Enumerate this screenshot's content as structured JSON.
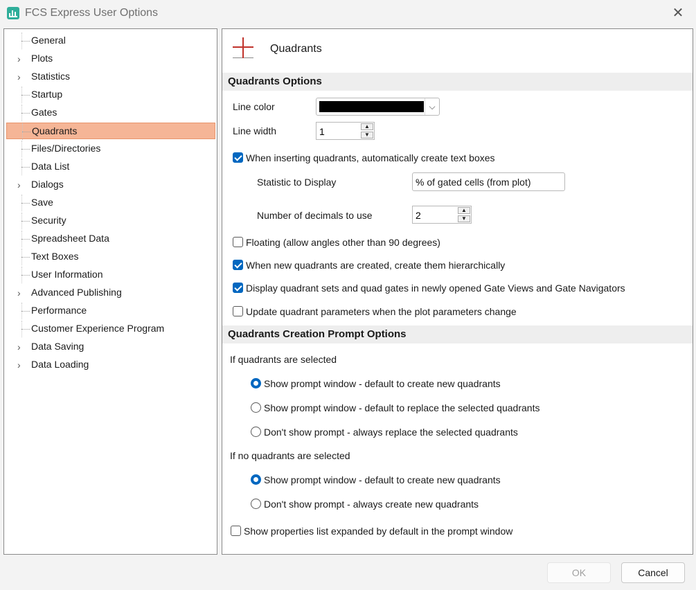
{
  "window": {
    "title": "FCS Express User Options"
  },
  "tree": {
    "items": [
      {
        "label": "General",
        "expandable": false
      },
      {
        "label": "Plots",
        "expandable": true
      },
      {
        "label": "Statistics",
        "expandable": true
      },
      {
        "label": "Startup",
        "expandable": false
      },
      {
        "label": "Gates",
        "expandable": false
      },
      {
        "label": "Quadrants",
        "expandable": false,
        "selected": true
      },
      {
        "label": "Files/Directories",
        "expandable": false
      },
      {
        "label": "Data List",
        "expandable": false
      },
      {
        "label": "Dialogs",
        "expandable": true
      },
      {
        "label": "Save",
        "expandable": false
      },
      {
        "label": "Security",
        "expandable": false
      },
      {
        "label": "Spreadsheet Data",
        "expandable": false
      },
      {
        "label": "Text Boxes",
        "expandable": false
      },
      {
        "label": "User Information",
        "expandable": false
      },
      {
        "label": "Advanced Publishing",
        "expandable": true
      },
      {
        "label": "Performance",
        "expandable": false
      },
      {
        "label": "Customer Experience Program",
        "expandable": false
      },
      {
        "label": "Data Saving",
        "expandable": true
      },
      {
        "label": "Data Loading",
        "expandable": true
      }
    ]
  },
  "panel": {
    "header_title": "Quadrants",
    "section1": "Quadrants Options",
    "line_color_label": "Line color",
    "line_color_value": "#000000",
    "line_width_label": "Line width",
    "line_width_value": "1",
    "auto_text_boxes": {
      "label": "When inserting quadrants, automatically create text boxes",
      "checked": true
    },
    "statistic_label": "Statistic to Display",
    "statistic_value": "% of gated cells (from plot)",
    "decimals_label": "Number of decimals to use",
    "decimals_value": "2",
    "floating": {
      "label": "Floating (allow angles other than 90 degrees)",
      "checked": false
    },
    "hierarchical": {
      "label": "When new quadrants are created, create them hierarchically",
      "checked": true
    },
    "display_sets": {
      "label": "Display quadrant sets and quad gates in newly opened Gate Views and Gate Navigators",
      "checked": true
    },
    "update_params": {
      "label": "Update quadrant parameters when the plot parameters change",
      "checked": false
    },
    "section2": "Quadrants Creation Prompt Options",
    "if_selected_label": "If quadrants are selected",
    "if_selected_options": [
      {
        "label": "Show prompt window - default to create new quadrants",
        "selected": true
      },
      {
        "label": "Show prompt window - default to replace the selected quadrants",
        "selected": false
      },
      {
        "label": "Don't show prompt - always replace the selected quadrants",
        "selected": false
      }
    ],
    "if_none_label": "If no quadrants are selected",
    "if_none_options": [
      {
        "label": "Show prompt window - default to create new quadrants",
        "selected": true
      },
      {
        "label": "Don't show prompt - always create new quadrants",
        "selected": false
      }
    ],
    "props_expanded": {
      "label": "Show properties list expanded by default in the prompt window",
      "checked": false
    }
  },
  "buttons": {
    "ok": "OK",
    "cancel": "Cancel"
  },
  "colors": {
    "accent": "#0067c0",
    "selection": "#f5b596",
    "quadrant_icon": "#c0322b"
  }
}
